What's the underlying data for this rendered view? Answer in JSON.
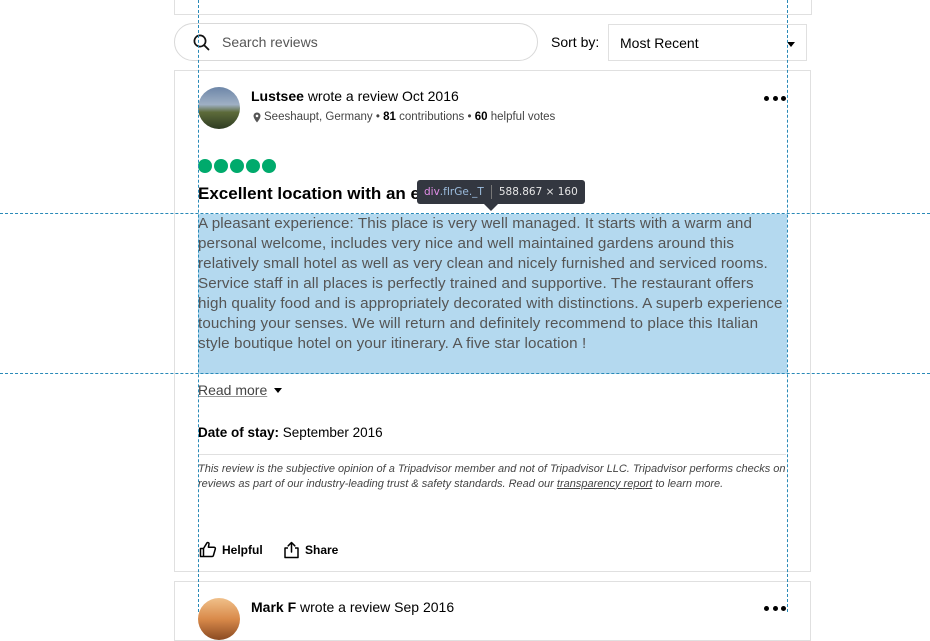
{
  "search": {
    "placeholder": "Search reviews"
  },
  "sort": {
    "label": "Sort by:",
    "value": "Most Recent"
  },
  "review": {
    "author": "Lustsee",
    "wrote": "wrote a review",
    "date": "Oct 2016",
    "location": "Seeshaupt, Germany",
    "contributions_count": "81",
    "contributions_label": "contributions",
    "helpful_count": "60",
    "helpful_label": "helpful votes",
    "rating": 5,
    "rating_color": "#00aa6c",
    "title_visible": "Excellent location with an e",
    "title_tail": "c",
    "body": "A pleasant experience: This place is very well managed. It starts with a warm and personal welcome, includes very nice and well maintained gardens around this relatively small hotel as well as very clean and nicely furnished and serviced rooms. Service staff in all places is perfectly trained and supportive. The restaurant offers high quality food and is appropriately decorated with distinctions. A superb experience touching your senses. We will return and definitely recommend to place this Italian style boutique hotel on your itinerary. A five star location !",
    "read_more": "Read more",
    "stay_label": "Date of stay:",
    "stay_value": "September 2016",
    "disclaimer_text": "This review is the subjective opinion of a Tripadvisor member and not of Tripadvisor LLC. Tripadvisor performs checks on reviews as part of our industry-leading trust & safety standards. Read our",
    "disclaimer_link": "transparency report",
    "disclaimer_end": "to learn more.",
    "helpful_button": "Helpful",
    "share_button": "Share"
  },
  "review2": {
    "author": "Mark F",
    "wrote": "wrote a review",
    "date": "Sep 2016"
  },
  "devtools": {
    "tag": "div",
    "class": ".fIrGe._T",
    "size": "588.867 × 160",
    "highlight_color": "#6fb7e1"
  }
}
